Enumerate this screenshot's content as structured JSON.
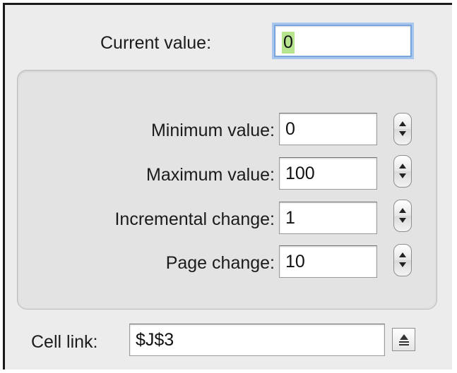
{
  "current_value": {
    "label": "Current value:",
    "value": "0"
  },
  "options": [
    {
      "id": "minimum",
      "label": "Minimum value:",
      "value": "0"
    },
    {
      "id": "maximum",
      "label": "Maximum value:",
      "value": "100"
    },
    {
      "id": "incremental",
      "label": "Incremental change:",
      "value": "1"
    },
    {
      "id": "page",
      "label": "Page change:",
      "value": "10"
    }
  ],
  "cell_link": {
    "label": "Cell link:",
    "value": "$J$3"
  },
  "icons": {
    "stepper": "up-down-stepper-icon",
    "collapse": "collapse-dialog-icon"
  },
  "colors": {
    "focus_ring": "#a9c7ee",
    "selection": "#b7e58f",
    "panel": "#ececec"
  }
}
